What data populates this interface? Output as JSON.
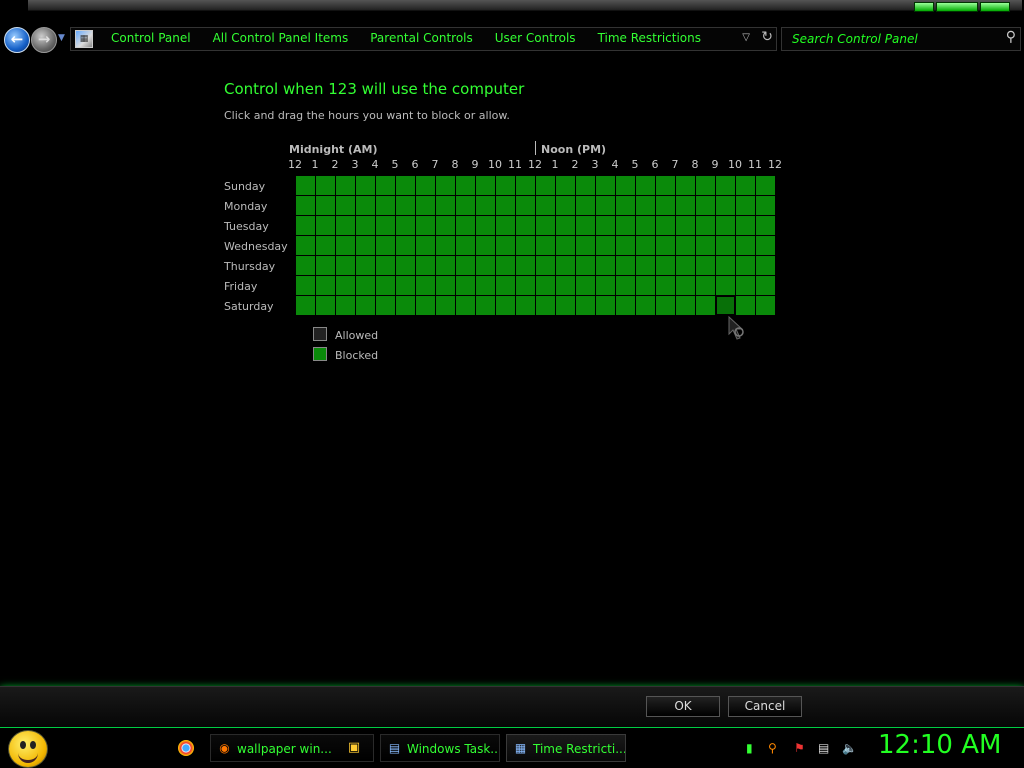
{
  "nav": {
    "breadcrumbs": [
      "Control Panel",
      "All Control Panel Items",
      "Parental Controls",
      "User Controls",
      "Time Restrictions"
    ],
    "search_placeholder": "Search Control Panel"
  },
  "content": {
    "title": "Control when 123 will use the computer",
    "instruction": "Click and drag the hours you want to block or allow.",
    "am_label": "Midnight (AM)",
    "pm_label": "Noon (PM)",
    "hour_labels": [
      "12",
      "1",
      "2",
      "3",
      "4",
      "5",
      "6",
      "7",
      "8",
      "9",
      "10",
      "11",
      "12",
      "1",
      "2",
      "3",
      "4",
      "5",
      "6",
      "7",
      "8",
      "9",
      "10",
      "11",
      "12"
    ],
    "days": [
      "Sunday",
      "Monday",
      "Tuesday",
      "Wednesday",
      "Thursday",
      "Friday",
      "Saturday"
    ],
    "legend": {
      "allowed": "Allowed",
      "blocked": "Blocked"
    },
    "colors": {
      "blocked": "#0a8a0a",
      "allowed": "#222222"
    },
    "highlighted_cell": {
      "day": "Saturday",
      "hour_index": 21
    }
  },
  "buttons": {
    "ok": "OK",
    "cancel": "Cancel"
  },
  "taskbar": {
    "tasks": [
      "wallpaper win...",
      "Windows Task...",
      "Time Restricti..."
    ],
    "clock": "12:10 AM"
  }
}
